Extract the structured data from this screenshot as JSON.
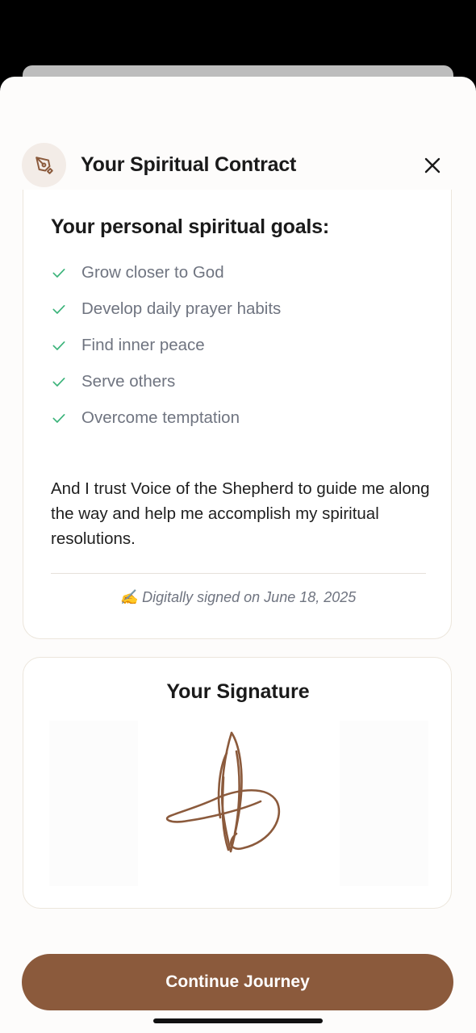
{
  "header": {
    "title": "Your Spiritual Contract",
    "icon": "pen-nib-icon",
    "close_icon": "close-icon"
  },
  "goals": {
    "title": "Your personal spiritual goals:",
    "items": [
      {
        "label": "Grow closer to God"
      },
      {
        "label": "Develop daily prayer habits"
      },
      {
        "label": "Find inner peace"
      },
      {
        "label": "Serve others"
      },
      {
        "label": "Overcome temptation"
      }
    ],
    "trust_text": "And I trust Voice of the Shepherd to guide me along the way and help me accomplish my spiritual resolutions.",
    "signed_text": "✍️ Digitally signed on June 18, 2025"
  },
  "signature": {
    "title": "Your Signature"
  },
  "footer": {
    "continue_label": "Continue Journey"
  },
  "colors": {
    "accent": "#8b5a3c",
    "check": "#3bb37a",
    "muted_text": "#6f7480"
  }
}
